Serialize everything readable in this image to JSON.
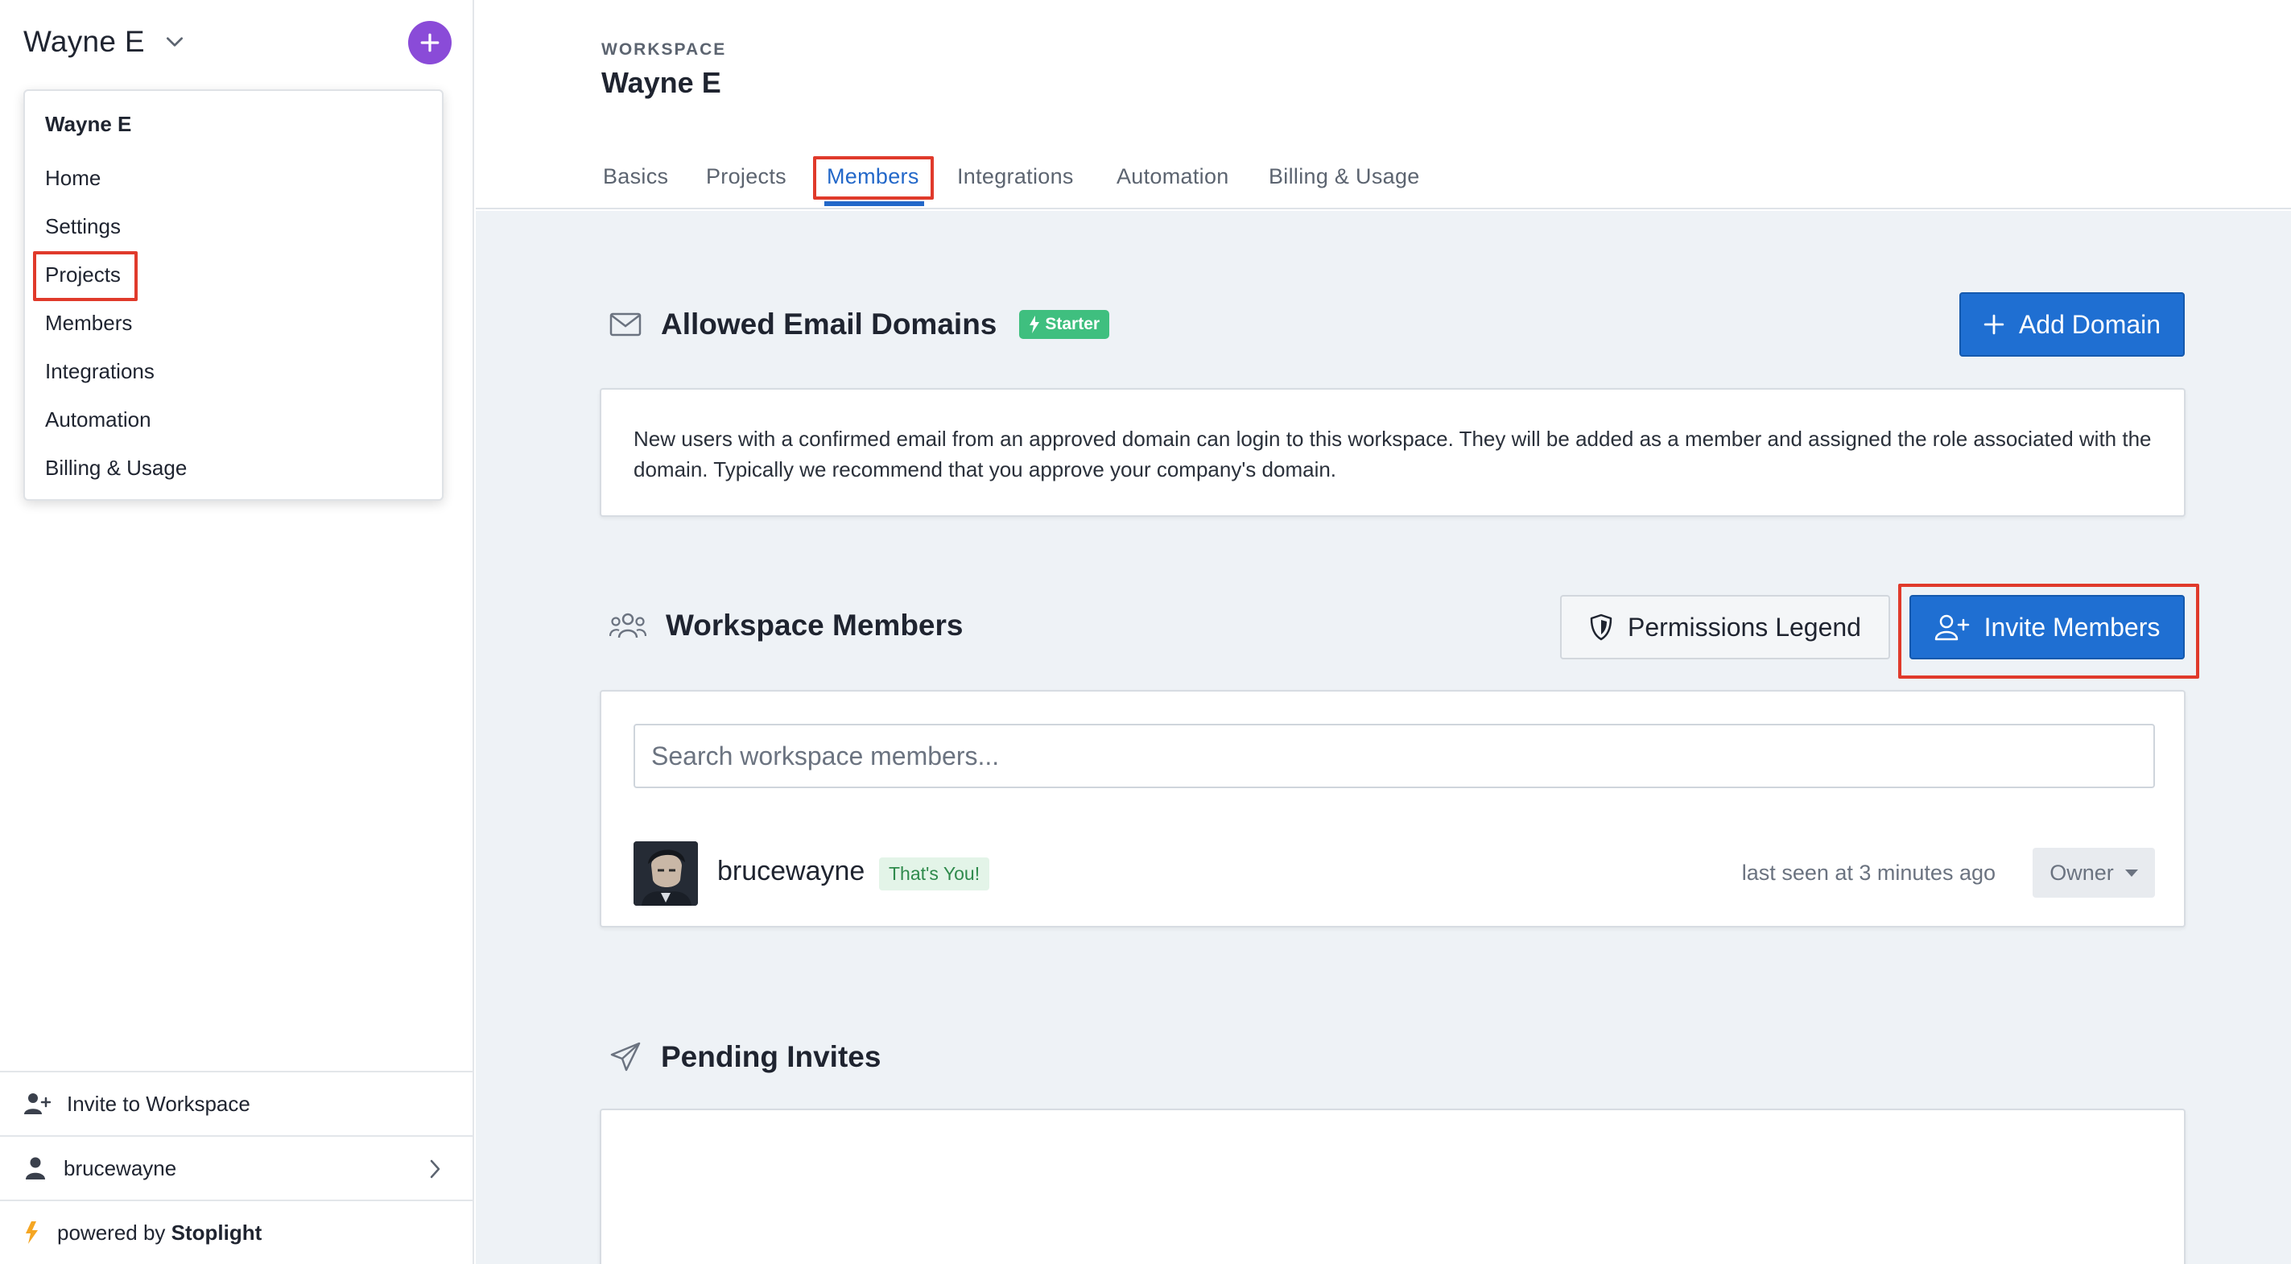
{
  "sidebar": {
    "workspace_name": "Wayne E",
    "menu": {
      "header": "Wayne E",
      "items": [
        "Home",
        "Settings",
        "Projects",
        "Members",
        "Integrations",
        "Automation",
        "Billing & Usage"
      ]
    },
    "invite_label": "Invite to Workspace",
    "user_label": "brucewayne",
    "powered_prefix": "powered by",
    "powered_brand": "Stoplight"
  },
  "header": {
    "kicker": "WORKSPACE",
    "title": "Wayne E",
    "tabs": [
      "Basics",
      "Projects",
      "Members",
      "Integrations",
      "Automation",
      "Billing & Usage"
    ],
    "active_tab": "Members"
  },
  "domains": {
    "title": "Allowed Email Domains",
    "badge": "Starter",
    "add_button": "Add Domain",
    "description": "New users with a confirmed email from an approved domain can login to this workspace. They will be added as a member and assigned the role associated with the domain. Typically we recommend that you approve your company's domain."
  },
  "members": {
    "title": "Workspace Members",
    "legend_button": "Permissions Legend",
    "invite_button": "Invite Members",
    "search_placeholder": "Search workspace members...",
    "list": [
      {
        "name": "brucewayne",
        "badge": "That's You!",
        "last_seen": "last seen at 3 minutes ago",
        "role": "Owner"
      }
    ]
  },
  "pending": {
    "title": "Pending Invites"
  },
  "colors": {
    "accent": "#1f6fd2",
    "add_circle": "#8a4bd8",
    "starter_badge": "#3fbf7f",
    "highlight": "#e03a2b"
  },
  "icons": {
    "domains": "envelope-icon",
    "members": "users-icon",
    "pending": "paper-plane-icon",
    "legend": "shield-icon",
    "invite": "user-plus-icon"
  }
}
